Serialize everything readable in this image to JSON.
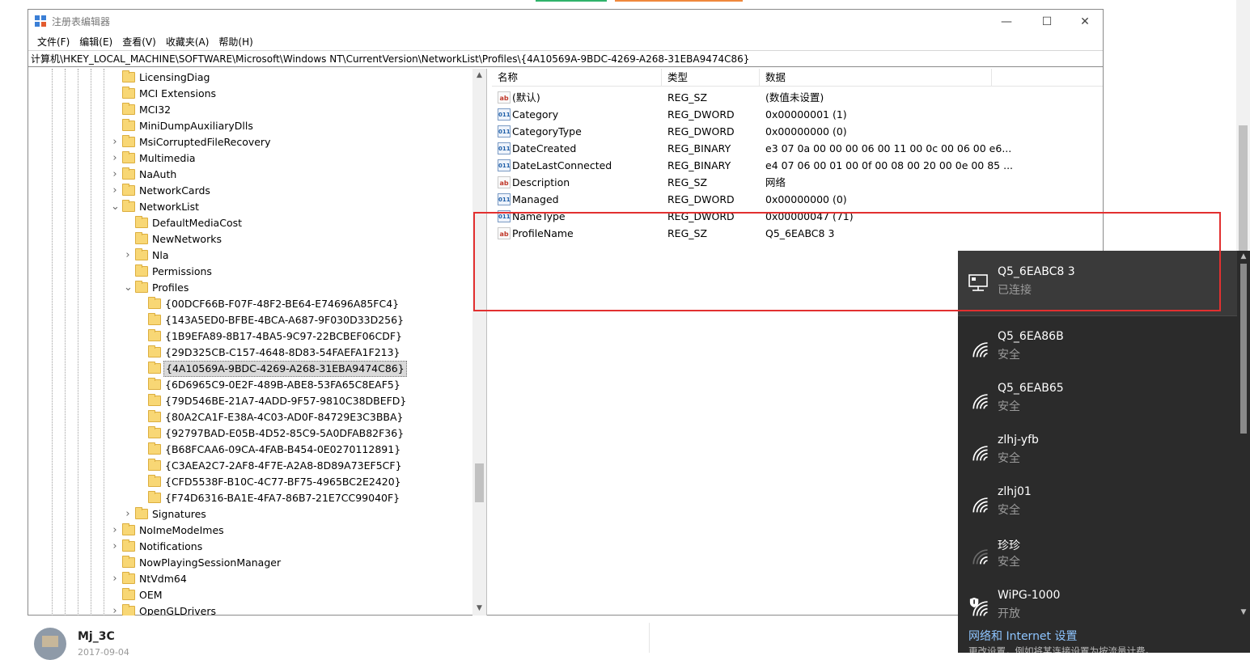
{
  "window": {
    "title": "注册表编辑器",
    "minimize_glyph": "—",
    "maximize_glyph": "☐",
    "close_glyph": "✕"
  },
  "menu": [
    "文件(F)",
    "编辑(E)",
    "查看(V)",
    "收藏夹(A)",
    "帮助(H)"
  ],
  "address": "计算机\\HKEY_LOCAL_MACHINE\\SOFTWARE\\Microsoft\\Windows NT\\CurrentVersion\\NetworkList\\Profiles\\{4A10569A-9BDC-4269-A268-31EBA9474C86}",
  "tree": [
    {
      "label": "LicensingDiag",
      "level": 0,
      "chevron": "",
      "selected": false
    },
    {
      "label": "MCI Extensions",
      "level": 0,
      "chevron": "",
      "selected": false
    },
    {
      "label": "MCI32",
      "level": 0,
      "chevron": "",
      "selected": false
    },
    {
      "label": "MiniDumpAuxiliaryDlls",
      "level": 0,
      "chevron": "",
      "selected": false
    },
    {
      "label": "MsiCorruptedFileRecovery",
      "level": 0,
      "chevron": ">",
      "selected": false
    },
    {
      "label": "Multimedia",
      "level": 0,
      "chevron": ">",
      "selected": false
    },
    {
      "label": "NaAuth",
      "level": 0,
      "chevron": ">",
      "selected": false
    },
    {
      "label": "NetworkCards",
      "level": 0,
      "chevron": ">",
      "selected": false
    },
    {
      "label": "NetworkList",
      "level": 0,
      "chevron": "v",
      "selected": false
    },
    {
      "label": "DefaultMediaCost",
      "level": 1,
      "chevron": "",
      "selected": false
    },
    {
      "label": "NewNetworks",
      "level": 1,
      "chevron": "",
      "selected": false
    },
    {
      "label": "Nla",
      "level": 1,
      "chevron": ">",
      "selected": false
    },
    {
      "label": "Permissions",
      "level": 1,
      "chevron": "",
      "selected": false
    },
    {
      "label": "Profiles",
      "level": 1,
      "chevron": "v",
      "selected": false
    },
    {
      "label": "{00DCF66B-F07F-48F2-BE64-E74696A85FC4}",
      "level": 2,
      "chevron": "",
      "selected": false
    },
    {
      "label": "{143A5ED0-BFBE-4BCA-A687-9F030D33D256}",
      "level": 2,
      "chevron": "",
      "selected": false
    },
    {
      "label": "{1B9EFA89-8B17-4BA5-9C97-22BCBEF06CDF}",
      "level": 2,
      "chevron": "",
      "selected": false
    },
    {
      "label": "{29D325CB-C157-4648-8D83-54FAEFA1F213}",
      "level": 2,
      "chevron": "",
      "selected": false
    },
    {
      "label": "{4A10569A-9BDC-4269-A268-31EBA9474C86}",
      "level": 2,
      "chevron": "",
      "selected": true
    },
    {
      "label": "{6D6965C9-0E2F-489B-ABE8-53FA65C8EAF5}",
      "level": 2,
      "chevron": "",
      "selected": false
    },
    {
      "label": "{79D546BE-21A7-4ADD-9F57-9810C38DBEFD}",
      "level": 2,
      "chevron": "",
      "selected": false
    },
    {
      "label": "{80A2CA1F-E38A-4C03-AD0F-84729E3C3BBA}",
      "level": 2,
      "chevron": "",
      "selected": false
    },
    {
      "label": "{92797BAD-E05B-4D52-85C9-5A0DFAB82F36}",
      "level": 2,
      "chevron": "",
      "selected": false
    },
    {
      "label": "{B68FCAA6-09CA-4FAB-B454-0E0270112891}",
      "level": 2,
      "chevron": "",
      "selected": false
    },
    {
      "label": "{C3AEA2C7-2AF8-4F7E-A2A8-8D89A73EF5CF}",
      "level": 2,
      "chevron": "",
      "selected": false
    },
    {
      "label": "{CFD5538F-B10C-4C77-BF75-4965BC2E2420}",
      "level": 2,
      "chevron": "",
      "selected": false
    },
    {
      "label": "{F74D6316-BA1E-4FA7-86B7-21E7CC99040F}",
      "level": 2,
      "chevron": "",
      "selected": false
    },
    {
      "label": "Signatures",
      "level": 1,
      "chevron": ">",
      "selected": false
    },
    {
      "label": "NoImeModeImes",
      "level": 0,
      "chevron": ">",
      "selected": false
    },
    {
      "label": "Notifications",
      "level": 0,
      "chevron": ">",
      "selected": false
    },
    {
      "label": "NowPlayingSessionManager",
      "level": 0,
      "chevron": "",
      "selected": false
    },
    {
      "label": "NtVdm64",
      "level": 0,
      "chevron": ">",
      "selected": false
    },
    {
      "label": "OEM",
      "level": 0,
      "chevron": "",
      "selected": false
    },
    {
      "label": "OpenGLDrivers",
      "level": 0,
      "chevron": ">",
      "selected": false
    }
  ],
  "value_columns": {
    "name": "名称",
    "type": "类型",
    "data": "数据"
  },
  "values": [
    {
      "icon": "ab",
      "name": "(默认)",
      "type": "REG_SZ",
      "data": "(数值未设置)"
    },
    {
      "icon": "bin",
      "name": "Category",
      "type": "REG_DWORD",
      "data": "0x00000001 (1)"
    },
    {
      "icon": "bin",
      "name": "CategoryType",
      "type": "REG_DWORD",
      "data": "0x00000000 (0)"
    },
    {
      "icon": "bin",
      "name": "DateCreated",
      "type": "REG_BINARY",
      "data": "e3 07 0a 00 00 00 06 00 11 00 0c 00 06 00 e6..."
    },
    {
      "icon": "bin",
      "name": "DateLastConnected",
      "type": "REG_BINARY",
      "data": "e4 07 06 00 01 00 0f 00 08 00 20 00 0e 00 85 ..."
    },
    {
      "icon": "ab",
      "name": "Description",
      "type": "REG_SZ",
      "data": "网络"
    },
    {
      "icon": "bin",
      "name": "Managed",
      "type": "REG_DWORD",
      "data": "0x00000000 (0)"
    },
    {
      "icon": "bin",
      "name": "NameType",
      "type": "REG_DWORD",
      "data": "0x00000047 (71)"
    },
    {
      "icon": "ab",
      "name": "ProfileName",
      "type": "REG_SZ",
      "data": "Q5_6EABC8 3"
    }
  ],
  "icon_text": {
    "ab": "ab",
    "bin": "011"
  },
  "flyout": {
    "connected": {
      "name": "Q5_6EABC8 3",
      "status": "已连接",
      "icon": "ethernet-icon"
    },
    "networks": [
      {
        "name": "Q5_6EA86B",
        "status": "安全",
        "icon": "wifi-icon",
        "strength": 1.0
      },
      {
        "name": "Q5_6EAB65",
        "status": "安全",
        "icon": "wifi-icon",
        "strength": 1.0
      },
      {
        "name": "zlhj-yfb",
        "status": "安全",
        "icon": "wifi-icon",
        "strength": 1.0
      },
      {
        "name": "zlhj01",
        "status": "安全",
        "icon": "wifi-icon",
        "strength": 1.0
      },
      {
        "name": "珍珍",
        "status": "安全",
        "icon": "wifi-icon",
        "strength": 0.5
      },
      {
        "name": "WiPG-1000",
        "status": "开放",
        "icon": "wifi-open-icon",
        "strength": 1.0
      }
    ],
    "settings_link": "网络和 Internet 设置",
    "settings_sub": "更改设置，例如将某连接设置为按流量计费。"
  },
  "background": {
    "user": "Mj_3C",
    "date": "2017-09-04"
  },
  "colors": {
    "accent_link": "#8ec5ff",
    "highlight": "#e23030",
    "flyout_bg": "#2b2b2b"
  }
}
